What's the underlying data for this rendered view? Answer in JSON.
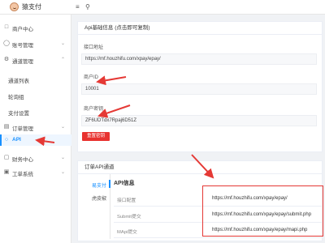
{
  "app": {
    "logo_text": "猿支付"
  },
  "topbar": {
    "menu_icon": "menu-icon",
    "search_icon": "search-icon"
  },
  "sidebar": {
    "items": [
      {
        "label": "商户中心",
        "icon": "home-icon"
      },
      {
        "label": "账号管理",
        "icon": "user-icon"
      },
      {
        "label": "通道管理",
        "icon": "gear-icon"
      },
      {
        "label": "通道列表"
      },
      {
        "label": "轮询组"
      },
      {
        "label": "支付设置"
      },
      {
        "label": "订单管理",
        "icon": "order-icon"
      },
      {
        "label": "API",
        "icon": "api-icon"
      },
      {
        "label": "财务中心",
        "icon": "finance-icon"
      },
      {
        "label": "工单系统",
        "icon": "ticket-icon"
      }
    ]
  },
  "api_basic": {
    "title": "Api基础信息 (点击即可复制)",
    "interface_label": "接口地址",
    "interface_value": "https://mf.houzhifu.com/xpay/epay/",
    "merchant_id_label": "商户ID",
    "merchant_id_value": "10001",
    "merchant_key_label": "商户密钥",
    "merchant_key_value": "ZF6UDTdx7Rpaj6D51Z",
    "reset_button": "重置密钥"
  },
  "order_api": {
    "title": "订单API通道",
    "tabs": [
      "易支付",
      "虎皮椒"
    ],
    "info_title": "API信息",
    "rows": [
      {
        "key": "接口配置",
        "value": "https://mf.houzhifu.com/xpay/epay/"
      },
      {
        "key": "Submit提交",
        "value": "https://mf.houzhifu.com/xpay/epay/submit.php"
      },
      {
        "key": "MApi提交",
        "value": "https://mf.houzhifu.com/xpay/epay/mapi.php"
      }
    ]
  },
  "colors": {
    "accent": "#1890ff",
    "annotation": "#e53935",
    "reset_button": "#e8322f"
  }
}
